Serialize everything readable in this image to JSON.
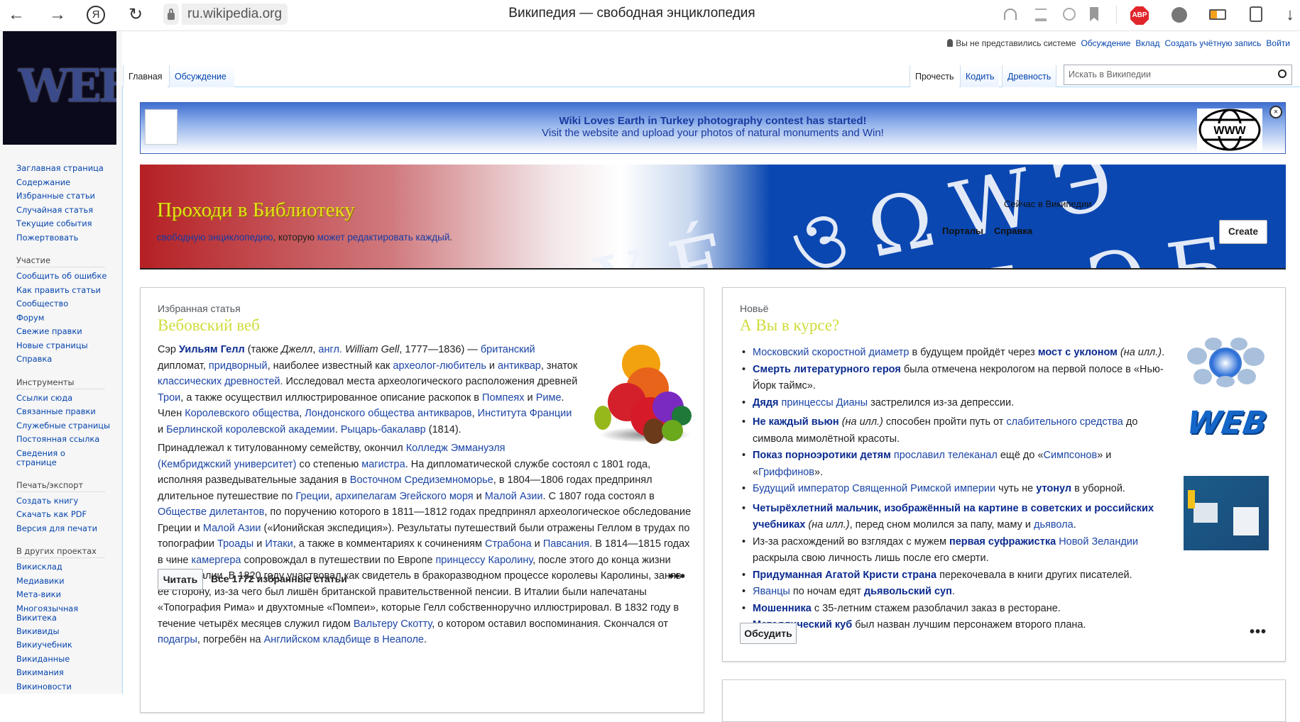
{
  "browser": {
    "url": "ru.wikipedia.org",
    "title": "Википедия — свободная энциклопедия",
    "back": "←",
    "forward": "→",
    "yandex": "Я",
    "reload": "↻",
    "abp": "ABP",
    "download": "↓"
  },
  "personal": {
    "status": "Вы не представились системе",
    "links": [
      "Обсуждение",
      "Вклад",
      "Создать учётную запись",
      "Войти"
    ]
  },
  "logo_text": "WEB",
  "tabs": {
    "left": [
      "Главная",
      "Обсуждение"
    ],
    "right": [
      "Прочесть",
      "Кодить",
      "Древность"
    ],
    "search_placeholder": "Искать в Википедии"
  },
  "sidebar": {
    "main": [
      "Заглавная страница",
      "Содержание",
      "Избранные статьи",
      "Случайная статья",
      "Текущие события",
      "Пожертвовать"
    ],
    "sections": [
      {
        "title": "Участие",
        "items": [
          "Сообщить об ошибке",
          "Как править статьи",
          "Сообщество",
          "Форум",
          "Свежие правки",
          "Новые страницы",
          "Справка"
        ]
      },
      {
        "title": "Инструменты",
        "items": [
          "Ссылки сюда",
          "Связанные правки",
          "Служебные страницы",
          "Постоянная ссылка",
          "Сведения о странице"
        ]
      },
      {
        "title": "Печать/экспорт",
        "items": [
          "Создать книгу",
          "Скачать как PDF",
          "Версия для печати"
        ]
      },
      {
        "title": "В других проектах",
        "items": [
          "Викисклад",
          "Медиавики",
          "Мета-вики",
          "Многоязычная Викитека",
          "Викивиды",
          "Викиучебник",
          "Викиданные",
          "Викимания",
          "Викиновости"
        ]
      }
    ]
  },
  "notice": {
    "line1": "Wiki Loves Earth in Turkey photography contest has started!",
    "line2": "Visit the website and upload your photos of natural monuments and Win!",
    "globe_label": "WWW",
    "close": "×"
  },
  "library": {
    "title": "Проходи в Библиотеку",
    "sub_link1": "свободную энциклопедию",
    "sub_text": ", которую ",
    "sub_link2": "может редактировать каждый",
    "sub_end": ".",
    "now": "Сейчас в Википедии",
    "glyphs": "YÉ ওΩWЭ",
    "glyphs2": "ИЯН ЭБ",
    "buttons": [
      "Порталы",
      "Справка"
    ],
    "create": "Create"
  },
  "featured": {
    "label": "Избранная статья",
    "title": "Вебовский веб",
    "paragraphs": [
      [
        {
          "t": "Сэр "
        },
        {
          "t": "Уильям Гелл",
          "s": "bl"
        },
        {
          "t": " (также "
        },
        {
          "t": "Джелл",
          "s": "it"
        },
        {
          "t": ", "
        },
        {
          "t": "англ.",
          "s": "lk"
        },
        {
          "t": " "
        },
        {
          "t": "William Gell",
          "s": "it"
        },
        {
          "t": ", 1777—1836) — "
        },
        {
          "t": "британский",
          "s": "lk"
        },
        {
          "t": " дипломат, "
        },
        {
          "t": "придворный",
          "s": "lk"
        },
        {
          "t": ", наиболее известный как "
        },
        {
          "t": "археолог-любитель",
          "s": "lk"
        },
        {
          "t": " и "
        },
        {
          "t": "антиквар",
          "s": "lk"
        },
        {
          "t": ", знаток "
        },
        {
          "t": "классических древностей",
          "s": "lk"
        },
        {
          "t": ". Исследовал места археологического расположения древней "
        },
        {
          "t": "Трои",
          "s": "lk"
        },
        {
          "t": ", а также осуществил иллюстрированное описание раскопок в "
        },
        {
          "t": "Помпеях",
          "s": "lk"
        },
        {
          "t": " и "
        },
        {
          "t": "Риме",
          "s": "lk"
        },
        {
          "t": ". Член "
        },
        {
          "t": "Королевского общества",
          "s": "lk"
        },
        {
          "t": ", "
        },
        {
          "t": "Лондонского общества антикваров",
          "s": "lk"
        },
        {
          "t": ", "
        },
        {
          "t": "Института Франции",
          "s": "lk"
        },
        {
          "t": " и "
        },
        {
          "t": "Берлинской королевской академии",
          "s": "lk"
        },
        {
          "t": ". "
        },
        {
          "t": "Рыцарь-бакалавр",
          "s": "lk"
        },
        {
          "t": " (1814)."
        }
      ],
      [
        {
          "t": "Принадлежал к титулованному семейству, окончил "
        },
        {
          "t": "Колледж Эммануэля (Кембриджский университет)",
          "s": "lk"
        },
        {
          "t": " со степенью "
        },
        {
          "t": "магистра",
          "s": "lk"
        },
        {
          "t": ". На дипломатической службе состоял с 1801 года, исполняя разведывательные задания в "
        },
        {
          "t": "Восточном Средиземноморье",
          "s": "lk"
        },
        {
          "t": ", в 1804—1806 годах предпринял длительное путешествие по "
        },
        {
          "t": "Греции",
          "s": "lk"
        },
        {
          "t": ", "
        },
        {
          "t": "архипелагам Эгейского моря",
          "s": "lk"
        },
        {
          "t": " и "
        },
        {
          "t": "Малой Азии",
          "s": "lk"
        },
        {
          "t": ". С 1807 года состоял в "
        },
        {
          "t": "Обществе дилетантов",
          "s": "lk"
        },
        {
          "t": ", по поручению которого в 1811—1812 годах предпринял археологическое обследование Греции и "
        },
        {
          "t": "Малой Азии",
          "s": "lk"
        },
        {
          "t": " («Ионийская экспедиция»). Результаты путешествий были отражены Геллом в трудах по топографии "
        },
        {
          "t": "Троады",
          "s": "lk"
        },
        {
          "t": " и "
        },
        {
          "t": "Итаки",
          "s": "lk"
        },
        {
          "t": ", а также в комментариях к сочинениям "
        },
        {
          "t": "Страбона",
          "s": "lk"
        },
        {
          "t": " и "
        },
        {
          "t": "Павсания",
          "s": "lk"
        },
        {
          "t": ". В 1814—1815 годах в чине "
        },
        {
          "t": "камергера",
          "s": "lk"
        },
        {
          "t": " сопровождал в путешествии по Европе "
        },
        {
          "t": "принцессу Каролину",
          "s": "lk"
        },
        {
          "t": ", после этого до конца жизни жил в Италии. В 1820 году участвовал как свидетель в бракоразводном процессе королевы Каролины, заняв её сторону, из-за чего был лишён британской правительственной пенсии. В Италии были напечатаны «Топография Рима» и двухтомные «Помпеи», которые Гелл собственноручно иллюстрировал. В 1832 году в течение четырёх месяцев служил гидом "
        },
        {
          "t": "Вальтеру Скотту",
          "s": "lk"
        },
        {
          "t": ", о котором оставил воспоминания. Скончался от "
        },
        {
          "t": "подагры",
          "s": "lk"
        },
        {
          "t": ", погребён на "
        },
        {
          "t": "Английском кладбище в Неаполе",
          "s": "lk"
        },
        {
          "t": "."
        }
      ]
    ],
    "read_button": "Читать",
    "all_link": "Все 1772 избранные статьи",
    "more": "•••"
  },
  "dyk": {
    "label": "Новьё",
    "title": "А Вы в курсе?",
    "items": [
      [
        {
          "t": "Московский скоростной диаметр",
          "s": "lk"
        },
        {
          "t": " в будущем пройдёт через "
        },
        {
          "t": "мост с уклоном",
          "s": "bl"
        },
        {
          "t": " "
        },
        {
          "t": "(на илл.)",
          "s": "it"
        },
        {
          "t": "."
        }
      ],
      [
        {
          "t": "Смерть литературного героя",
          "s": "bl"
        },
        {
          "t": " была отмечена некрологом на первой полосе в «Нью-Йорк таймс»."
        }
      ],
      [
        {
          "t": "Дядя",
          "s": "bl"
        },
        {
          "t": " "
        },
        {
          "t": "принцессы Дианы",
          "s": "lk"
        },
        {
          "t": " застрелился из-за депрессии."
        }
      ],
      [
        {
          "t": "Не каждый вьюн",
          "s": "bl"
        },
        {
          "t": " "
        },
        {
          "t": "(на илл.)",
          "s": "it"
        },
        {
          "t": " способен пройти путь от "
        },
        {
          "t": "слабительного средства",
          "s": "lk"
        },
        {
          "t": " до символа мимолётной красоты."
        }
      ],
      [
        {
          "t": "Показ порноэротики детям",
          "s": "bl"
        },
        {
          "t": " "
        },
        {
          "t": "прославил телеканал",
          "s": "lk"
        },
        {
          "t": " ещё до «"
        },
        {
          "t": "Симпсонов",
          "s": "lk"
        },
        {
          "t": "» и «"
        },
        {
          "t": "Гриффинов",
          "s": "lk"
        },
        {
          "t": "»."
        }
      ],
      [
        {
          "t": "Будущий император Священной Римской империи",
          "s": "lk"
        },
        {
          "t": " чуть не "
        },
        {
          "t": "утонул",
          "s": "bl"
        },
        {
          "t": " в уборной."
        }
      ],
      [
        {
          "t": "Четырёхлетний мальчик, изображённый на картине в советских и российских учебниках",
          "s": "bl"
        },
        {
          "t": " "
        },
        {
          "t": "(на илл.)",
          "s": "it"
        },
        {
          "t": ", перед сном молился за папу, маму и "
        },
        {
          "t": "дьявола",
          "s": "lk"
        },
        {
          "t": "."
        }
      ],
      [
        {
          "t": "Из-за расхождений во взглядах с мужем "
        },
        {
          "t": "первая суфражистка",
          "s": "bl"
        },
        {
          "t": " "
        },
        {
          "t": "Новой Зеландии",
          "s": "lk"
        },
        {
          "t": " раскрыла свою личность лишь после его смерти."
        }
      ],
      [
        {
          "t": "Придуманная Агатой Кристи страна",
          "s": "bl"
        },
        {
          "t": " перекочевала в книги других писателей."
        }
      ],
      [
        {
          "t": "Яванцы",
          "s": "lk"
        },
        {
          "t": " по ночам едят "
        },
        {
          "t": "дьявольский суп",
          "s": "bl"
        },
        {
          "t": "."
        }
      ],
      [
        {
          "t": "Мошенника",
          "s": "bl"
        },
        {
          "t": " с 35-летним стажем разоблачил заказ в ресторане."
        }
      ],
      [
        {
          "t": "Металлический куб",
          "s": "bl"
        },
        {
          "t": " был назван лучшим персонажем второго плана."
        }
      ]
    ],
    "discuss_button": "Обсудить",
    "more": "•••",
    "web_img_text": "WEB"
  }
}
